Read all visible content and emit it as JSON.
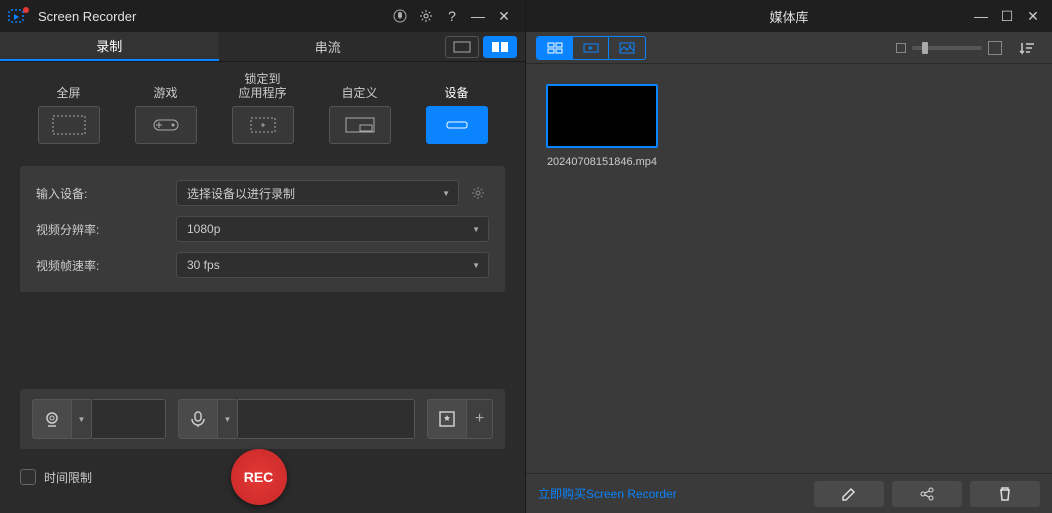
{
  "left": {
    "app_title": "Screen Recorder",
    "tabs": {
      "record": "录制",
      "stream": "串流"
    },
    "modes": {
      "fullscreen": "全屏",
      "game": "游戏",
      "lock_app": "锁定到\n应用程序",
      "custom": "自定义",
      "device": "设备"
    },
    "settings": {
      "input_device_label": "输入设备:",
      "input_device_value": "选择设备以进行录制",
      "resolution_label": "视频分辨率:",
      "resolution_value": "1080p",
      "framerate_label": "视频帧速率:",
      "framerate_value": "30 fps"
    },
    "time_limit_label": "时间限制",
    "rec_label": "REC"
  },
  "right": {
    "title": "媒体库",
    "media": [
      {
        "name": "20240708151846.mp4"
      }
    ],
    "buy_link": "立即购买Screen Recorder"
  }
}
